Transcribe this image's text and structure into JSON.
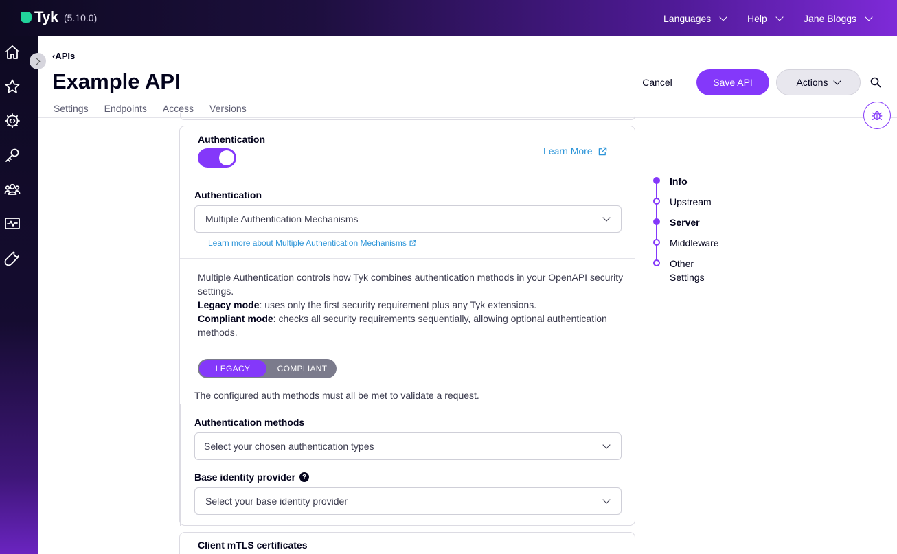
{
  "app": {
    "brand": "Tyk",
    "version": "(5.10.0)"
  },
  "topbar": {
    "menus": [
      "Languages",
      "Help",
      "Jane Bloggs"
    ]
  },
  "sidebar": {
    "items": [
      {
        "icon": "home-icon"
      },
      {
        "icon": "star-icon"
      },
      {
        "icon": "api-gear-icon"
      },
      {
        "icon": "key-icon"
      },
      {
        "icon": "users-icon"
      },
      {
        "icon": "monitor-activity-icon"
      },
      {
        "icon": "wrench-icon"
      }
    ]
  },
  "header": {
    "breadcrumb": "APIs",
    "title": "Example API",
    "tabs": [
      "Settings",
      "Endpoints",
      "Access",
      "Versions"
    ],
    "cancel_label": "Cancel",
    "save_label": "Save API",
    "actions_label": "Actions"
  },
  "auth_section": {
    "title": "Authentication",
    "toggle_on": true,
    "learn_more": "Learn More",
    "auth_label": "Authentication",
    "auth_value": "Multiple Authentication Mechanisms",
    "auth_link": "Learn more about Multiple Authentication Mechanisms",
    "desc_line1": "Multiple Authentication controls how Tyk combines authentication methods in your OpenAPI security settings.",
    "legacy_term": "Legacy mode",
    "legacy_text": ": uses only the first security requirement plus any Tyk extensions.",
    "compliant_term": "Compliant mode",
    "compliant_text": ": checks all security requirements sequentially, allowing optional authentication methods.",
    "mode_options": [
      "LEGACY",
      "COMPLIANT"
    ],
    "mode_selected": "LEGACY",
    "note": "The configured auth methods must all be met to validate a request.",
    "methods_label": "Authentication methods",
    "methods_placeholder": "Select your chosen authentication types",
    "idp_label": "Base identity provider",
    "idp_placeholder": "Select your base identity provider"
  },
  "next_section": {
    "title": "Client mTLS certificates"
  },
  "stepper": {
    "steps": [
      {
        "label": "Info",
        "active": true
      },
      {
        "label": "Upstream",
        "active": false
      },
      {
        "label": "Server",
        "active": true
      },
      {
        "label": "Middleware",
        "active": false
      },
      {
        "label": "Other Settings",
        "active": false
      }
    ]
  },
  "colors": {
    "accent": "#8438fa",
    "link": "#2b94d8",
    "brand_green": "#22d39b"
  }
}
